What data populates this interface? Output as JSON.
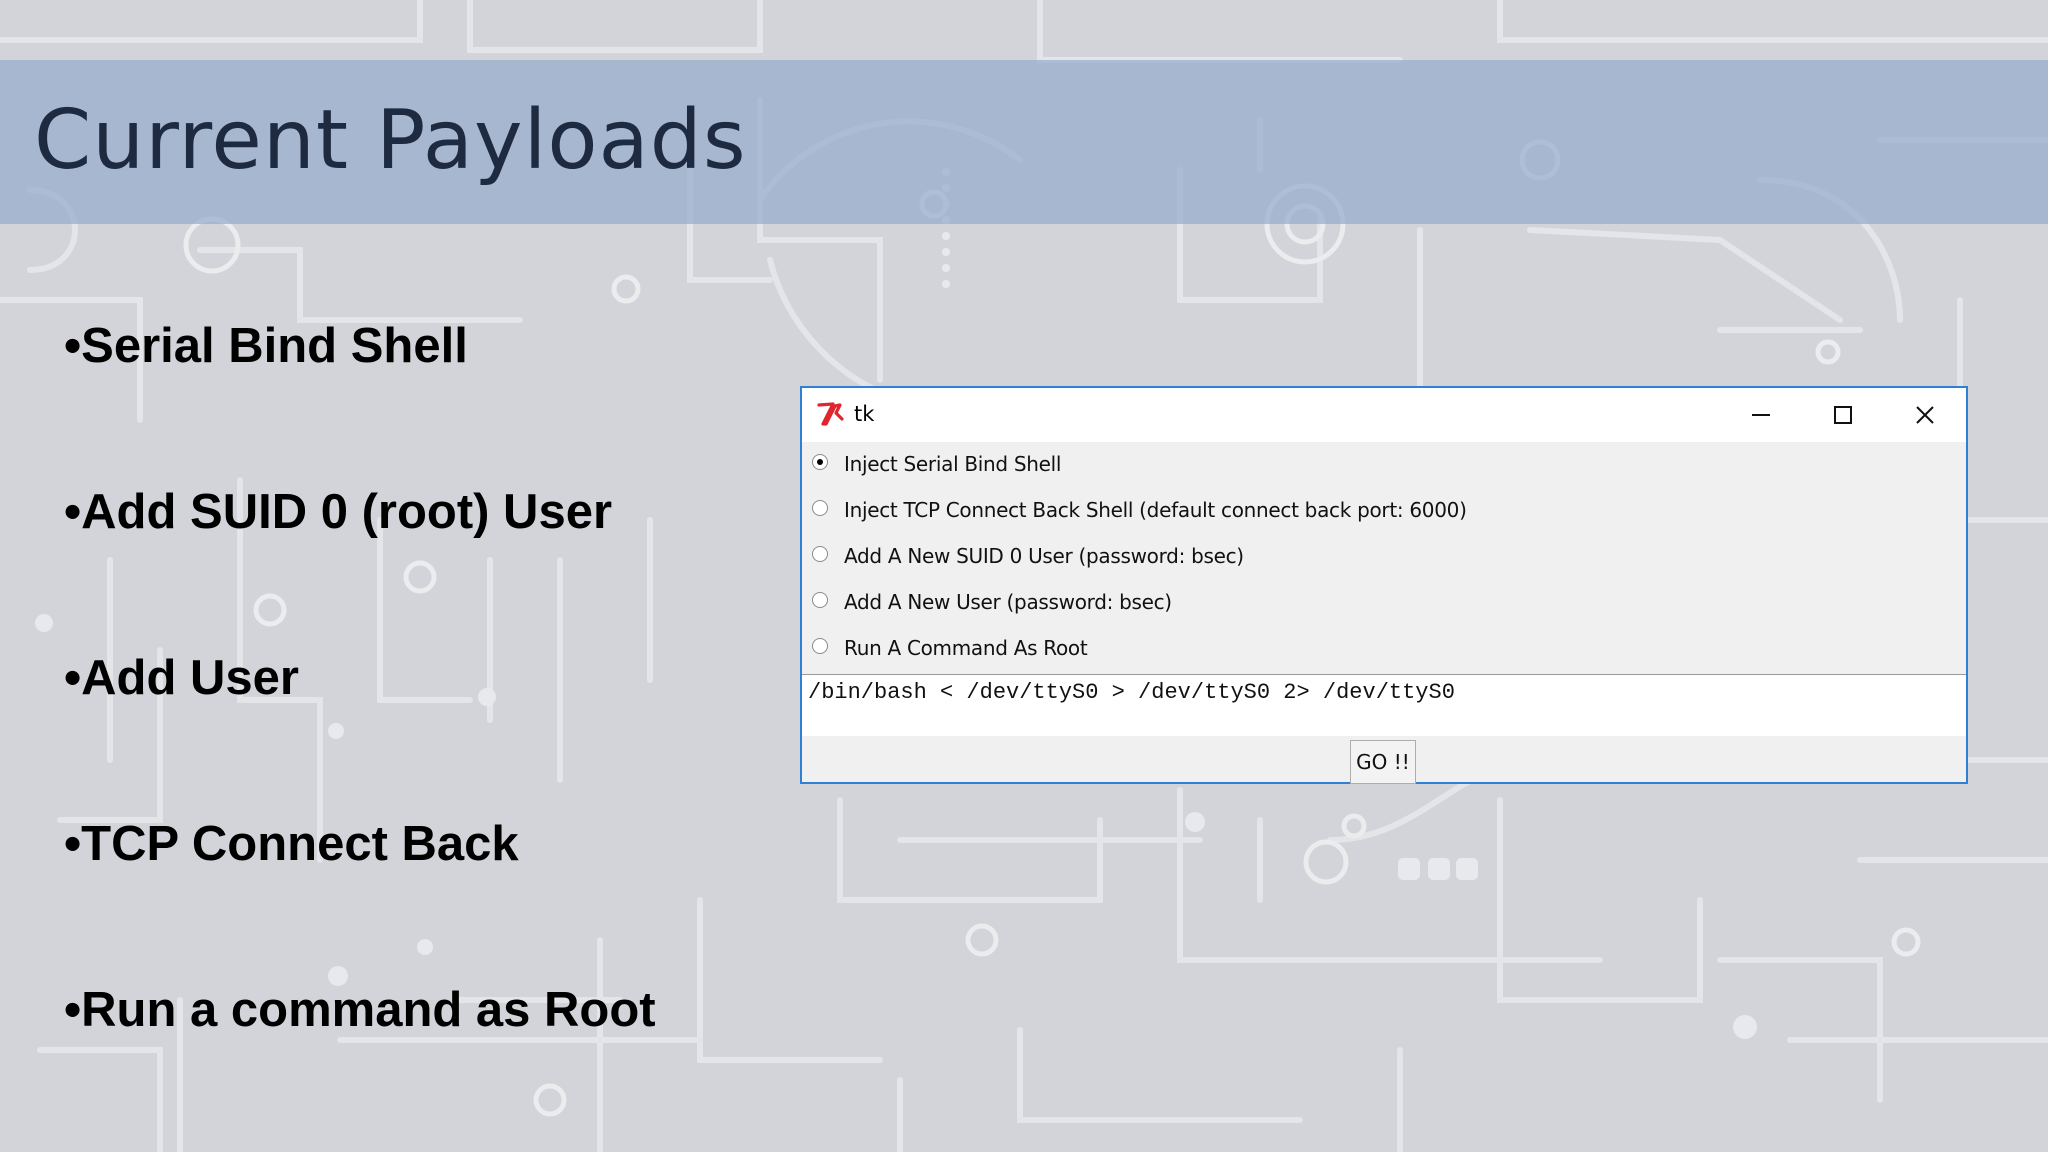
{
  "slide": {
    "title": "Current Payloads",
    "bullets": [
      "•Serial Bind Shell",
      "•Add SUID 0 (root) User",
      "•Add User",
      "•TCP Connect Back",
      "•Run a command as Root"
    ]
  },
  "window": {
    "title": "tk",
    "options": [
      {
        "label": "Inject Serial Bind Shell",
        "selected": true
      },
      {
        "label": "Inject TCP Connect Back Shell (default connect back port: 6000)",
        "selected": false
      },
      {
        "label": "Add A New SUID 0 User (password: bsec)",
        "selected": false
      },
      {
        "label": "Add A New User (password: bsec)",
        "selected": false
      },
      {
        "label": "Run A Command As Root",
        "selected": false
      }
    ],
    "command_value": "/bin/bash < /dev/ttyS0 > /dev/ttyS0 2> /dev/ttyS0",
    "go_label": "GO !!"
  },
  "colors": {
    "window_border": "#2f7fd3",
    "title_band": "#96accc",
    "tk_logo": "#e0262d"
  },
  "icons": {
    "app": "tk-feather-icon",
    "minimize": "minimize-icon",
    "maximize": "maximize-icon",
    "close": "close-icon"
  }
}
